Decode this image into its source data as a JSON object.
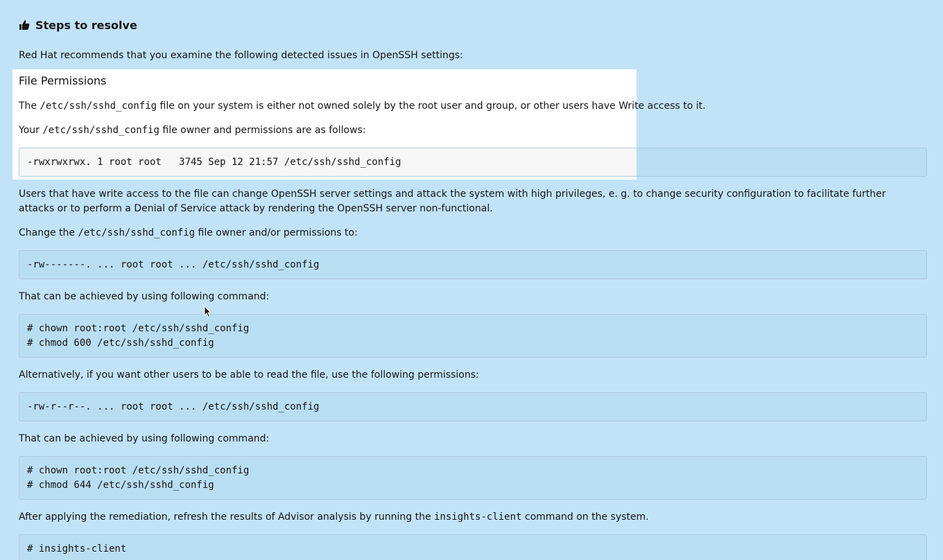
{
  "section": {
    "icon": "thumbs-up-icon",
    "title": "Steps to resolve"
  },
  "intro": "Red Hat recommends that you examine the following detected issues in OpenSSH settings:",
  "file_permissions": {
    "title": "File Permissions",
    "desc": {
      "pre": "The ",
      "code": "/etc/ssh/sshd_config",
      "post": " file on your system is either not owned solely by the root user and group, or other users have Write access to it."
    },
    "owner_line": {
      "pre": "Your ",
      "code": "/etc/ssh/sshd_config",
      "post": " file owner and permissions are as follows:"
    },
    "current": "-rwxrwxrwx. 1 root root   3745 Sep 12 21:57 /etc/ssh/sshd_config"
  },
  "risk": "Users that have write access to the file can change OpenSSH server settings and attack the system with high privileges, e. g. to change security configuration to facilitate further attacks or to perform a Denial of Service attack by rendering the OpenSSH server non-functional.",
  "change_line": {
    "pre": "Change the ",
    "code": "/etc/ssh/sshd_config",
    "post": " file owner and/or permissions to:"
  },
  "recommended_perms": "-rw-------. ... root root ... /etc/ssh/sshd_config",
  "command_intro_1": "That can be achieved by using following command:",
  "commands_1": [
    "# chown root:root /etc/ssh/sshd_config",
    "# chmod 600 /etc/ssh/sshd_config"
  ],
  "alternative": "Alternatively, if you want other users to be able to read the file, use the following permissions:",
  "alternative_perms": "-rw-r--r--. ... root root ... /etc/ssh/sshd_config",
  "command_intro_2": "That can be achieved by using following command:",
  "commands_2": [
    "# chown root:root /etc/ssh/sshd_config",
    "# chmod 644 /etc/ssh/sshd_config"
  ],
  "after": {
    "pre": "After applying the remediation, refresh the results of Advisor analysis by running the ",
    "code": "insights-client",
    "post": " command on the system."
  },
  "final_command": "# insights-client"
}
